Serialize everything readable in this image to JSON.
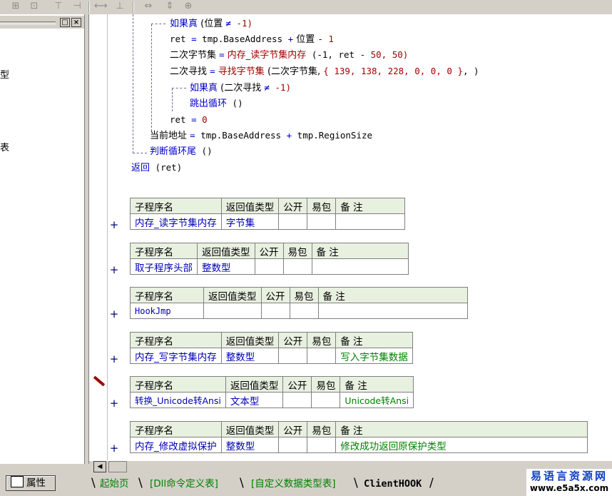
{
  "left_panel": {
    "fragments": [
      "型",
      "表"
    ],
    "property_button": "属性"
  },
  "code_lines": [
    {
      "parts": [
        {
          "t": "如果真",
          "c": "kw"
        },
        {
          "t": " (位置 ",
          "c": "plain"
        },
        {
          "t": "≠",
          "c": "op"
        },
        {
          "t": " -1)",
          "c": "num"
        }
      ]
    },
    {
      "parts": [
        {
          "t": "ret ",
          "c": "plain"
        },
        {
          "t": "=",
          "c": "op"
        },
        {
          "t": " tmp.BaseAddress ",
          "c": "plain"
        },
        {
          "t": "+",
          "c": "op"
        },
        {
          "t": " 位置 ",
          "c": "plain"
        },
        {
          "t": "-",
          "c": "op"
        },
        {
          "t": " 1",
          "c": "num"
        }
      ]
    },
    {
      "parts": [
        {
          "t": "二次字节集 ",
          "c": "plain"
        },
        {
          "t": "=",
          "c": "op"
        },
        {
          "t": " 内存_读字节集内存",
          "c": "fn"
        },
        {
          "t": " (-1, ret ",
          "c": "plain"
        },
        {
          "t": "-",
          "c": "op"
        },
        {
          "t": " 50, 50)",
          "c": "num"
        }
      ]
    },
    {
      "parts": [
        {
          "t": "二次寻找 ",
          "c": "plain"
        },
        {
          "t": "=",
          "c": "op"
        },
        {
          "t": " 寻找字节集",
          "c": "fn"
        },
        {
          "t": " (二次字节集, ",
          "c": "plain"
        },
        {
          "t": "{ 139, 138, 228, 0, 0, 0 }",
          "c": "num"
        },
        {
          "t": ", )",
          "c": "plain"
        }
      ]
    },
    {
      "parts": [
        {
          "t": "如果真",
          "c": "kw"
        },
        {
          "t": " (二次寻找 ",
          "c": "plain"
        },
        {
          "t": "≠",
          "c": "op"
        },
        {
          "t": " -1)",
          "c": "num"
        }
      ]
    },
    {
      "parts": [
        {
          "t": "跳出循环",
          "c": "kw"
        },
        {
          "t": " ()",
          "c": "plain"
        }
      ]
    },
    {
      "parts": [
        {
          "t": "ret ",
          "c": "plain"
        },
        {
          "t": "=",
          "c": "op"
        },
        {
          "t": " 0",
          "c": "num"
        }
      ]
    },
    {
      "parts": [
        {
          "t": "当前地址 ",
          "c": "plain"
        },
        {
          "t": "=",
          "c": "op"
        },
        {
          "t": " tmp.BaseAddress ",
          "c": "plain"
        },
        {
          "t": "+",
          "c": "op"
        },
        {
          "t": " tmp.RegionSize",
          "c": "plain"
        }
      ]
    },
    {
      "parts": [
        {
          "t": "判断循环尾",
          "c": "kw"
        },
        {
          "t": " ()",
          "c": "plain"
        }
      ]
    },
    {
      "parts": [
        {
          "t": "返回",
          "c": "kw"
        },
        {
          "t": " (ret)",
          "c": "plain"
        }
      ]
    }
  ],
  "subprograms": [
    {
      "header": [
        "子程序名",
        "返回值类型",
        "公开",
        "易包",
        "备 注"
      ],
      "name": "内存_读字节集内存",
      "ret": "字节集",
      "public": "",
      "pkg": "",
      "note": ""
    },
    {
      "header": [
        "子程序名",
        "返回值类型",
        "公开",
        "易包",
        "备 注"
      ],
      "name": "取子程序头部",
      "ret": "整数型",
      "public": "",
      "pkg": "",
      "note": ""
    },
    {
      "header": [
        "子程序名",
        "返回值类型",
        "公开",
        "易包",
        "备 注"
      ],
      "name": "HookJmp",
      "ret": "",
      "public": "",
      "pkg": "",
      "note": ""
    },
    {
      "header": [
        "子程序名",
        "返回值类型",
        "公开",
        "易包",
        "备 注"
      ],
      "name": "内存_写字节集内存",
      "ret": "整数型",
      "public": "",
      "pkg": "",
      "note": "写入字节集数据"
    },
    {
      "header": [
        "子程序名",
        "返回值类型",
        "公开",
        "易包",
        "备 注"
      ],
      "name": "转换_Unicode转Ansi",
      "ret": "文本型",
      "public": "",
      "pkg": "",
      "note": "Unicode转Ansi"
    },
    {
      "header": [
        "子程序名",
        "返回值类型",
        "公开",
        "易包",
        "备 注"
      ],
      "name": "内存_修改虚拟保护",
      "ret": "整数型",
      "public": "",
      "pkg": "",
      "note": "修改成功返回原保护类型"
    }
  ],
  "plus_sign": "+",
  "tabs": [
    {
      "label": "起始页",
      "active": false
    },
    {
      "label": "[Dll命令定义表]",
      "active": false
    },
    {
      "label": "[自定义数据类型表]",
      "active": false
    },
    {
      "label": "ClientHOOK",
      "active": true
    }
  ],
  "logo": {
    "line1": "易语言资源网",
    "line2": "www.e5a5x.com"
  },
  "colors": {
    "keyword": "#0000c8",
    "function": "#a00000",
    "table_header_bg": "#e8f0e0",
    "note": "#008000",
    "tab_text": "#008000"
  },
  "toolbar_icons": [
    "align-left-icon",
    "align-center-icon",
    "align-top-icon",
    "align-right-icon",
    "distribute-h-icon",
    "distribute-v-icon",
    "same-width-icon",
    "same-height-icon",
    "same-size-icon"
  ]
}
